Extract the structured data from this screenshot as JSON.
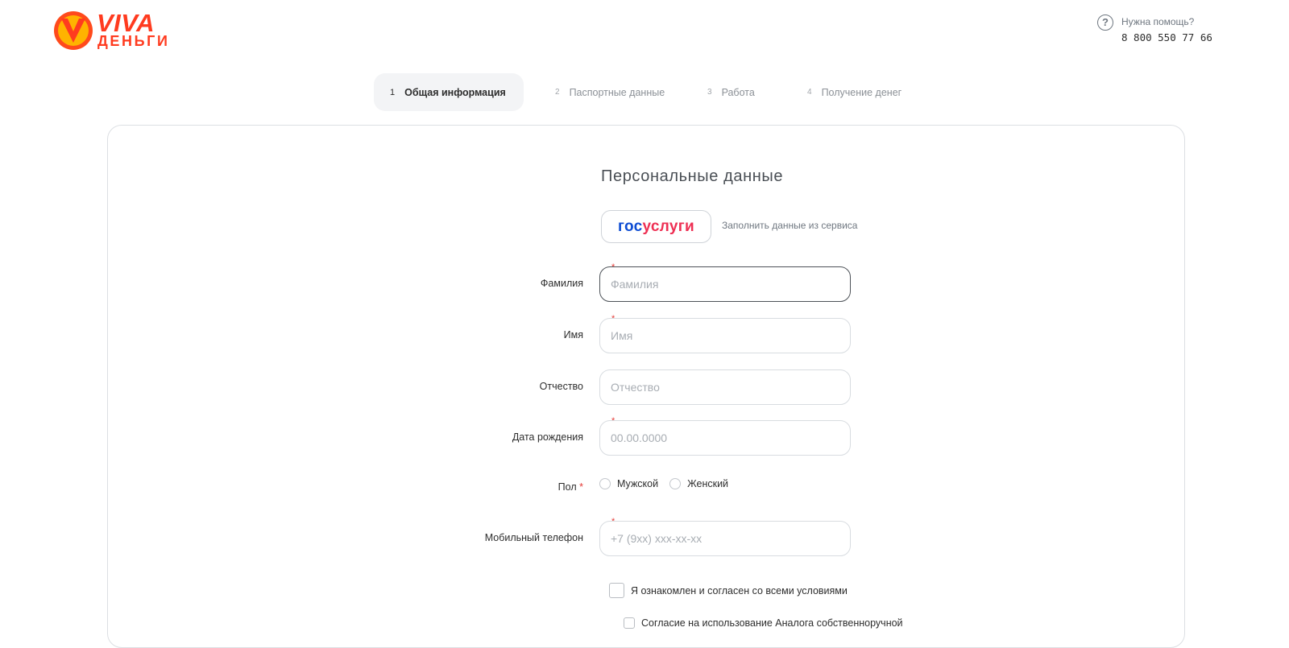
{
  "header": {
    "logo": {
      "word1": "VIVA",
      "word2": "ДЕНЬГИ"
    },
    "help": {
      "title": "Нужна помощь?",
      "phone": "8 800 550 77 66",
      "icon": "help-circle-icon"
    }
  },
  "steps": [
    {
      "num": "1",
      "label": "Общая информация",
      "active": true
    },
    {
      "num": "2",
      "label": "Паспортные данные",
      "active": false
    },
    {
      "num": "3",
      "label": "Работа",
      "active": false
    },
    {
      "num": "4",
      "label": "Получение денег",
      "active": false
    }
  ],
  "form": {
    "title": "Персональные данные",
    "gosuslugi": {
      "logo_part1": "гос",
      "logo_part2": "услуги",
      "hint": "Заполнить данные из сервиса"
    },
    "fields": {
      "last_name": {
        "label": "Фамилия",
        "placeholder": "Фамилия",
        "value": ""
      },
      "first_name": {
        "label": "Имя",
        "placeholder": "Имя",
        "value": ""
      },
      "middle_name": {
        "label": "Отчество",
        "placeholder": "Отчество",
        "value": ""
      },
      "birth_date": {
        "label": "Дата рождения",
        "placeholder": "00.00.0000",
        "value": ""
      },
      "gender": {
        "label": "Пол",
        "options": [
          "Мужской",
          "Женский"
        ]
      },
      "phone": {
        "label": "Мобильный телефон",
        "placeholder": "+7 (9xx) xxx-xx-xx",
        "value": ""
      }
    },
    "required_mark": "*",
    "agree_all": "Я ознакомлен и согласен со всеми условиями",
    "agree_signature": "Согласие на использование Аналога собственноручной"
  },
  "colors": {
    "brand": "#ff3b1f",
    "required": "#e53935",
    "gos_blue": "#0d4cd3",
    "gos_red": "#ee2f53"
  }
}
